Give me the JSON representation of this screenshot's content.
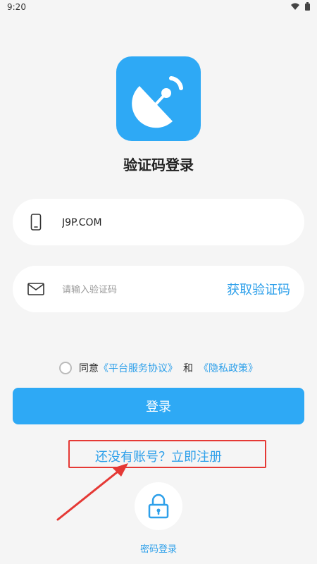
{
  "status_bar": {
    "time": "9:20"
  },
  "page": {
    "title": "验证码登录"
  },
  "phone_field": {
    "value": "J9P.COM"
  },
  "code_field": {
    "placeholder": "请输入验证码",
    "get_code_label": "获取验证码"
  },
  "agreement": {
    "prefix": "同意",
    "terms_link": "《平台服务协议》",
    "and": "和",
    "privacy_link": "《隐私政策》"
  },
  "login_button": {
    "label": "登录"
  },
  "register": {
    "label": "还没有账号？立即注册"
  },
  "password_login": {
    "label": "密码登录"
  },
  "colors": {
    "accent": "#2ea9f5",
    "link": "#2ea0ea",
    "highlight": "#e53935"
  }
}
